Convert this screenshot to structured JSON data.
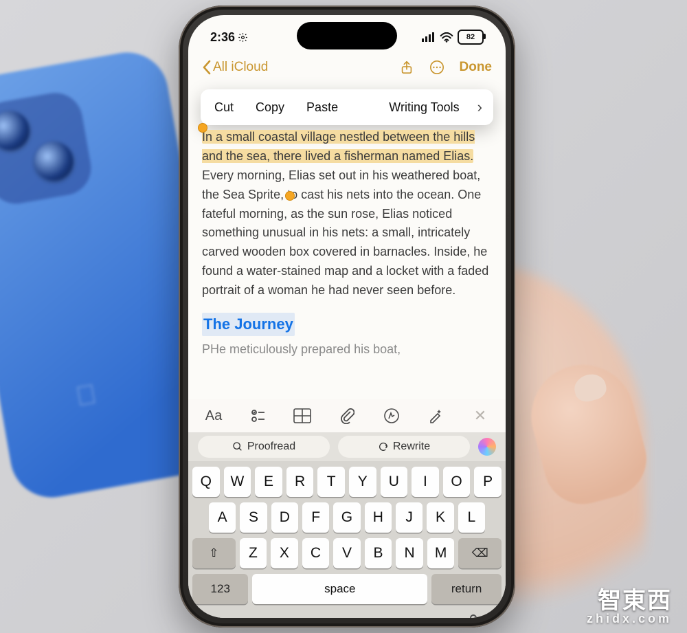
{
  "status": {
    "time": "2:36",
    "battery": "82"
  },
  "nav": {
    "back": "All iCloud",
    "done": "Done"
  },
  "popover": {
    "cut": "Cut",
    "copy": "Copy",
    "paste": "Paste",
    "writing_tools": "Writing Tools"
  },
  "note": {
    "selected": "In a small coastal village nestled between the hills and the sea, there lived a fisherman named Elias.",
    "rest": " Every morning, Elias set out in his weathered boat, the Sea Sprite, to cast his nets into the ocean. One fateful morning, as the sun rose, Elias noticed something unusual in his nets: a small, intricately carved wooden box covered in barnacles. Inside, he found a water-stained map and a locket with a faded portrait of a woman he had never seen before.",
    "h2": "The Journey",
    "p2": "PHe meticulously prepared his boat,"
  },
  "toolbar": {
    "aa": "Aa"
  },
  "wt": {
    "proofread": "Proofread",
    "rewrite": "Rewrite"
  },
  "keyboard": {
    "row1": [
      "Q",
      "W",
      "E",
      "R",
      "T",
      "Y",
      "U",
      "I",
      "O",
      "P"
    ],
    "row2": [
      "A",
      "S",
      "D",
      "F",
      "G",
      "H",
      "J",
      "K",
      "L"
    ],
    "row3": [
      "Z",
      "X",
      "C",
      "V",
      "B",
      "N",
      "M"
    ],
    "shift": "⇧",
    "backspace": "⌫",
    "numbers": "123",
    "space": "space",
    "return": "return"
  },
  "watermark": {
    "line1": "智東西",
    "line2": "zhidx.com"
  }
}
